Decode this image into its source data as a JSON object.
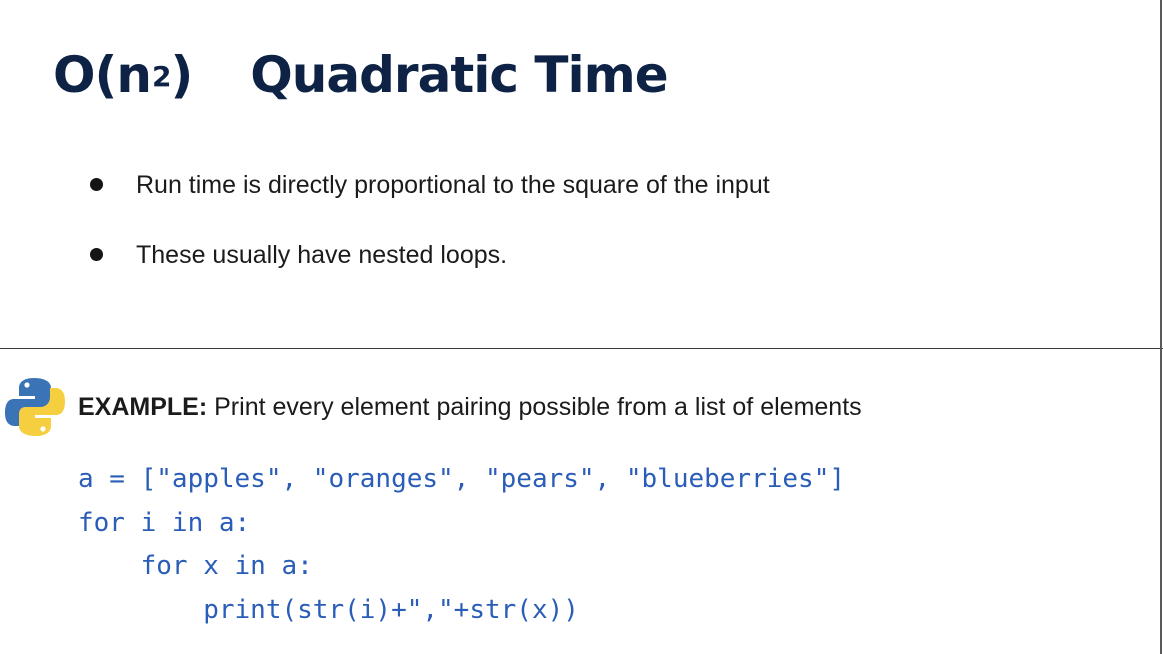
{
  "title": {
    "notation_prefix": "O(n",
    "exponent": "2",
    "notation_suffix": ")",
    "text": "Quadratic Time"
  },
  "bullets": [
    "Run time is directly proportional to the square of the input",
    "These usually have nested loops."
  ],
  "example": {
    "logo_icon": "python-logo-icon",
    "label": "EXAMPLE:",
    "description": " Print every element pairing possible from a list of elements"
  },
  "code": {
    "lines": [
      "a = [\"apples\", \"oranges\", \"pears\", \"blueberries\"]",
      "for i in a:",
      "    for x in a:",
      "        print(str(i)+\",\"+str(x))"
    ]
  },
  "colors": {
    "title": "#0e2245",
    "code": "#2a5db8",
    "python_blue": "#3a74b6",
    "python_yellow": "#f5cf40"
  }
}
